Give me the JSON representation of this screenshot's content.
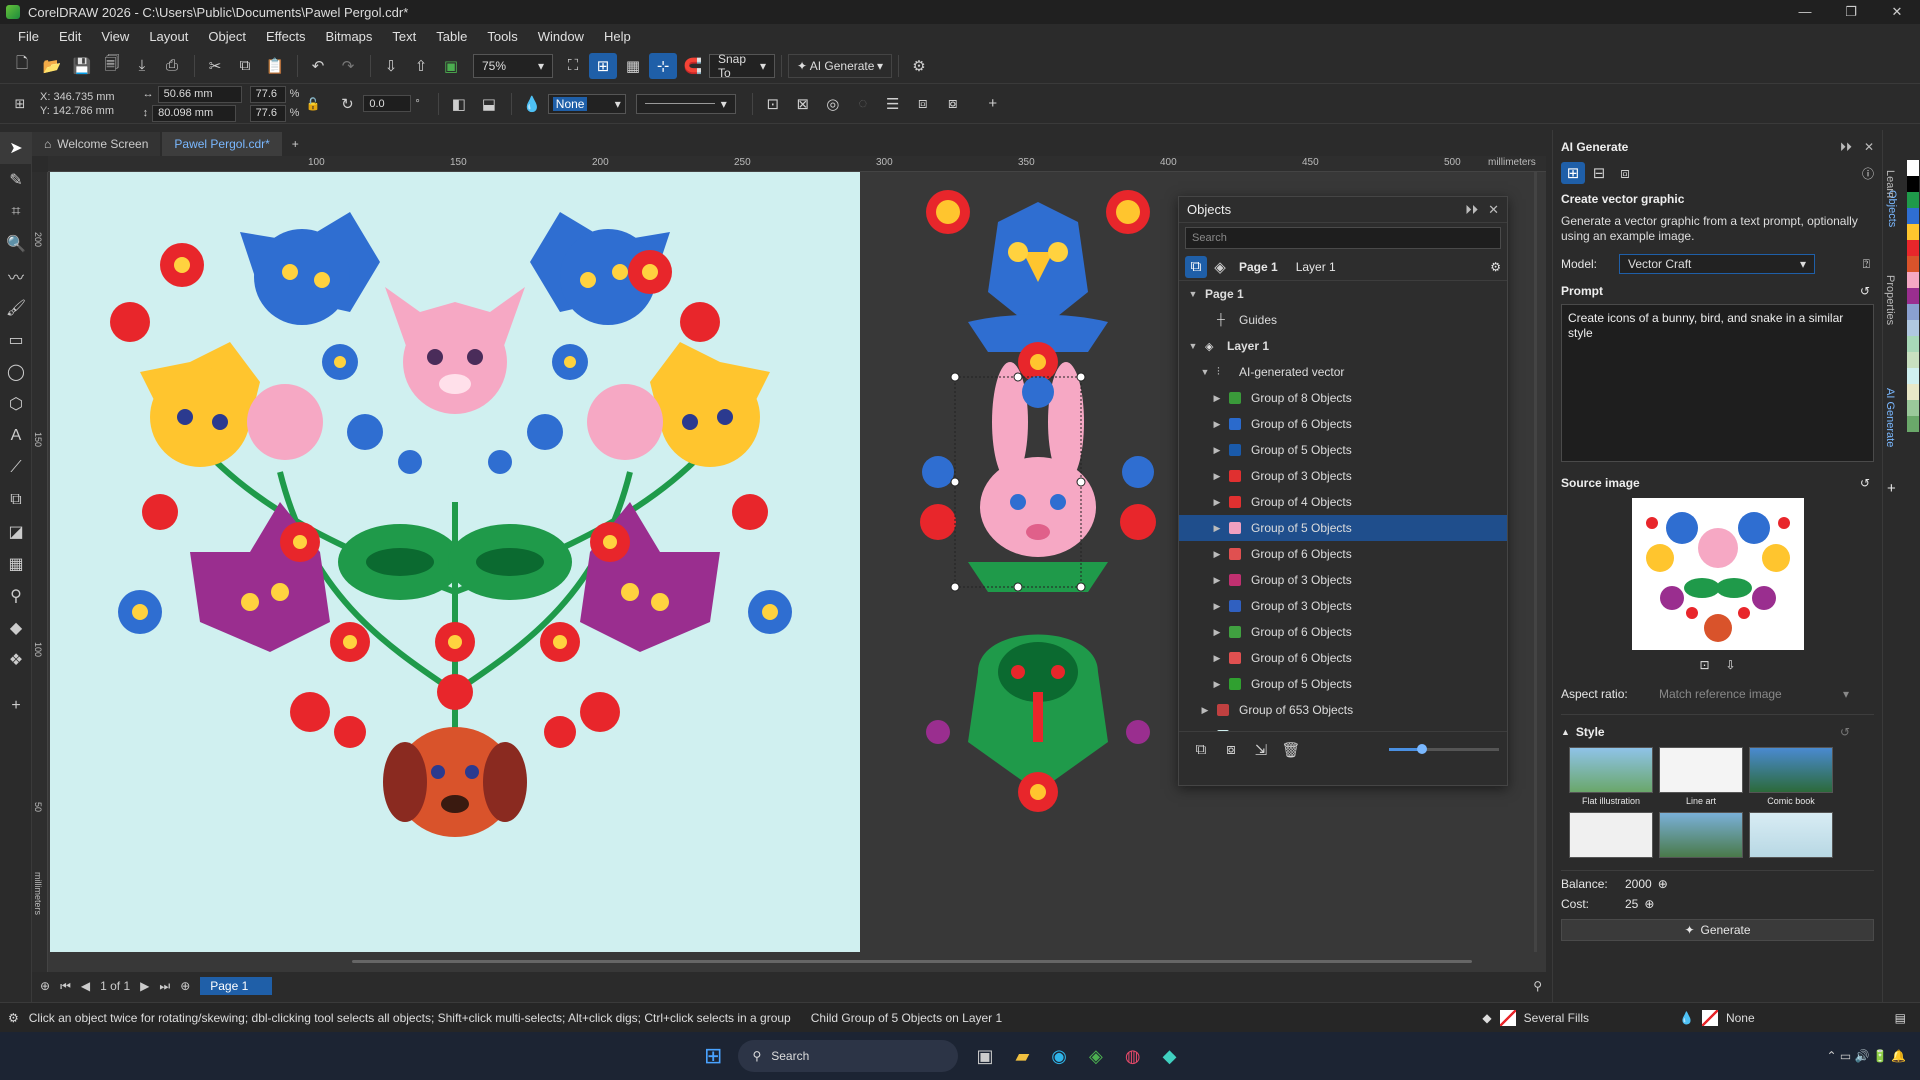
{
  "window": {
    "title": "CorelDRAW 2026 - C:\\Users\\Public\\Documents\\Pawel Pergol.cdr*"
  },
  "menu": [
    "File",
    "Edit",
    "View",
    "Layout",
    "Object",
    "Effects",
    "Bitmaps",
    "Text",
    "Table",
    "Tools",
    "Window",
    "Help"
  ],
  "toolbar": {
    "zoom": "75%",
    "snap": "Snap To",
    "ai_generate": "AI Generate"
  },
  "propbar": {
    "x": "X: 346.735 mm",
    "y": "Y: 142.786 mm",
    "w": "50.66 mm",
    "h": "80.098 mm",
    "sx": "77.6",
    "sy": "77.6",
    "pct": "%",
    "rotation": "0.0",
    "deg": "°",
    "fill": "None"
  },
  "tabs": [
    "Welcome Screen",
    "Pawel Pergol.cdr*"
  ],
  "ruler": {
    "ticks": [
      "100",
      "150",
      "200",
      "250",
      "300",
      "350",
      "400",
      "450",
      "500"
    ],
    "unit": "millimeters",
    "vticks": [
      "200",
      "150",
      "100",
      "50"
    ],
    "vunit": "millimeters"
  },
  "pagebar": {
    "count": "1 of 1",
    "page": "Page 1"
  },
  "objects": {
    "title": "Objects",
    "search_placeholder": "Search",
    "page": "Page 1",
    "layer": "Layer 1",
    "tree": [
      {
        "label": "Page 1",
        "indent": 0,
        "arrow": "▼",
        "icon": "none"
      },
      {
        "label": "Guides",
        "indent": 1,
        "arrow": "",
        "icon": "guides"
      },
      {
        "label": "Layer 1",
        "indent": 0,
        "arrow": "▼",
        "icon": "layer"
      },
      {
        "label": "AI-generated vector",
        "indent": 1,
        "arrow": "▼",
        "icon": "vector"
      },
      {
        "label": "Group of 8 Objects",
        "indent": 2,
        "arrow": "▶",
        "icon": "#3a9a3a"
      },
      {
        "label": "Group of 6 Objects",
        "indent": 2,
        "arrow": "▶",
        "icon": "#2a6acc"
      },
      {
        "label": "Group of 5 Objects",
        "indent": 2,
        "arrow": "▶",
        "icon": "#1a5aaa"
      },
      {
        "label": "Group of 3 Objects",
        "indent": 2,
        "arrow": "▶",
        "icon": "#e03030"
      },
      {
        "label": "Group of 4 Objects",
        "indent": 2,
        "arrow": "▶",
        "icon": "#e03030"
      },
      {
        "label": "Group of 5 Objects",
        "indent": 2,
        "arrow": "▶",
        "icon": "#f0a0c0",
        "selected": true
      },
      {
        "label": "Group of 6 Objects",
        "indent": 2,
        "arrow": "▶",
        "icon": "#e05050"
      },
      {
        "label": "Group of 3 Objects",
        "indent": 2,
        "arrow": "▶",
        "icon": "#c03070"
      },
      {
        "label": "Group of 3 Objects",
        "indent": 2,
        "arrow": "▶",
        "icon": "#3060c0"
      },
      {
        "label": "Group of 6 Objects",
        "indent": 2,
        "arrow": "▶",
        "icon": "#40a040"
      },
      {
        "label": "Group of 6 Objects",
        "indent": 2,
        "arrow": "▶",
        "icon": "#e05050"
      },
      {
        "label": "Group of 5 Objects",
        "indent": 2,
        "arrow": "▶",
        "icon": "#30a030"
      },
      {
        "label": "Group of 653 Objects",
        "indent": 1,
        "arrow": "▶",
        "icon": "#c04040"
      },
      {
        "label": "Rectangle",
        "indent": 1,
        "arrow": "",
        "icon": "#d0f0f0"
      }
    ]
  },
  "ai": {
    "title": "AI Generate",
    "heading": "Create vector graphic",
    "description": "Generate a vector graphic from a text prompt, optionally using an example image.",
    "model_label": "Model:",
    "model": "Vector Craft",
    "prompt_label": "Prompt",
    "prompt": "Create icons of a bunny, bird, and snake in a similar style",
    "source_label": "Source image",
    "aspect_label": "Aspect ratio:",
    "aspect": "Match reference image",
    "style_label": "Style",
    "styles": [
      "Flat illustration",
      "Line art",
      "Comic book",
      "",
      "",
      ""
    ],
    "balance_label": "Balance:",
    "balance": "2000",
    "cost_label": "Cost:",
    "cost": "25",
    "generate": "Generate"
  },
  "side_tabs": [
    "Objects",
    "Learn",
    "Properties",
    "AI Generate"
  ],
  "status": {
    "hint": "Click an object twice for rotating/skewing; dbl-clicking tool selects all objects; Shift+click multi-selects; Alt+click digs; Ctrl+click selects in a group",
    "selection": "Child Group of 5 Objects on Layer 1",
    "fill": "Several Fills",
    "outline": "None"
  },
  "taskbar": {
    "search": "Search"
  },
  "colors": {
    "accent": "#1f5fa8",
    "page": "#d0f0f0",
    "selection": "#1f4e8c"
  }
}
